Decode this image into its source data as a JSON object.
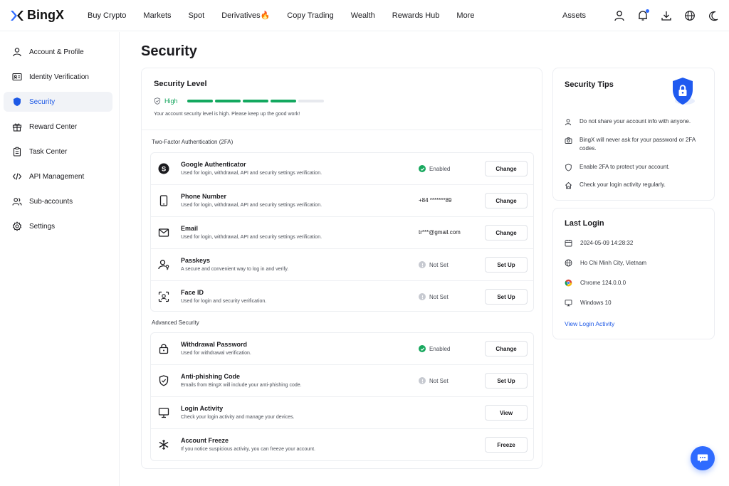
{
  "brand": {
    "name": "BingX",
    "accent": "#2f6bff"
  },
  "nav": {
    "items": [
      "Buy Crypto",
      "Markets",
      "Spot",
      "Derivatives🔥",
      "Copy Trading",
      "Wealth",
      "Rewards Hub",
      "More"
    ],
    "assets": "Assets",
    "icons": [
      "user-icon",
      "bell-icon",
      "download-icon",
      "globe-icon",
      "moon-icon"
    ]
  },
  "sidebar": {
    "items": [
      {
        "label": "Account & Profile",
        "icon": "user-icon"
      },
      {
        "label": "Identity Verification",
        "icon": "id-card-icon"
      },
      {
        "label": "Security",
        "icon": "shield-icon",
        "active": true
      },
      {
        "label": "Reward Center",
        "icon": "gift-icon"
      },
      {
        "label": "Task Center",
        "icon": "clipboard-icon"
      },
      {
        "label": "API Management",
        "icon": "code-icon"
      },
      {
        "label": "Sub-accounts",
        "icon": "users-icon"
      },
      {
        "label": "Settings",
        "icon": "gear-icon"
      }
    ]
  },
  "page": {
    "title": "Security"
  },
  "security_level": {
    "title": "Security Level",
    "level": "High",
    "progress_segments_filled": 4,
    "progress_segments_total": 5,
    "message": "Your account security level is high. Please keep up the good work!"
  },
  "two_fa": {
    "label": "Two-Factor Authentication (2FA)",
    "rows": [
      {
        "title": "Google Authenticator",
        "desc": "Used for login, withdrawal, API and security settings verification.",
        "status": "Enabled",
        "button": "Change",
        "icon": "google-authenticator-icon"
      },
      {
        "title": "Phone Number",
        "desc": "Used for login, withdrawal, API and security settings verification.",
        "value": "+84 *******89",
        "button": "Change",
        "icon": "phone-icon"
      },
      {
        "title": "Email",
        "desc": "Used for login, withdrawal, API and security settings verification.",
        "value": "tr***@gmail.com",
        "button": "Change",
        "icon": "mail-icon"
      },
      {
        "title": "Passkeys",
        "desc": "A secure and convenient way to log in and verify.",
        "status": "Not Set",
        "button": "Set Up",
        "icon": "passkey-icon"
      },
      {
        "title": "Face ID",
        "desc": "Used for login and security verification.",
        "status": "Not Set",
        "button": "Set Up",
        "icon": "face-id-icon"
      }
    ]
  },
  "advanced": {
    "label": "Advanced Security",
    "rows": [
      {
        "title": "Withdrawal Password",
        "desc": "Used for withdrawal verification.",
        "status": "Enabled",
        "button": "Change",
        "icon": "lock-icon"
      },
      {
        "title": "Anti-phishing Code",
        "desc": "Emails from BingX will include your anti-phishing code.",
        "status": "Not Set",
        "button": "Set Up",
        "icon": "shield-check-icon"
      },
      {
        "title": "Login Activity",
        "desc": "Check your login activity and manage your devices.",
        "button": "View",
        "icon": "monitor-icon"
      },
      {
        "title": "Account Freeze",
        "desc": "If you notice suspicious activity, you can freeze your account.",
        "button": "Freeze",
        "icon": "snowflake-icon"
      }
    ]
  },
  "tips": {
    "title": "Security Tips",
    "items": [
      "Do not share your account info with anyone.",
      "BingX will never ask for your password or 2FA codes.",
      "Enable 2FA to protect your account.",
      "Check your login activity regularly."
    ]
  },
  "last_login": {
    "title": "Last Login",
    "time": "2024-05-09 14:28:32",
    "location": "Ho Chi Minh City, Vietnam",
    "browser": "Chrome 124.0.0.0",
    "os": "Windows 10",
    "link": "View Login Activity"
  },
  "colors": {
    "success": "#18a85e",
    "link": "#1e59e6",
    "muted_dot": "#c7cad1"
  }
}
